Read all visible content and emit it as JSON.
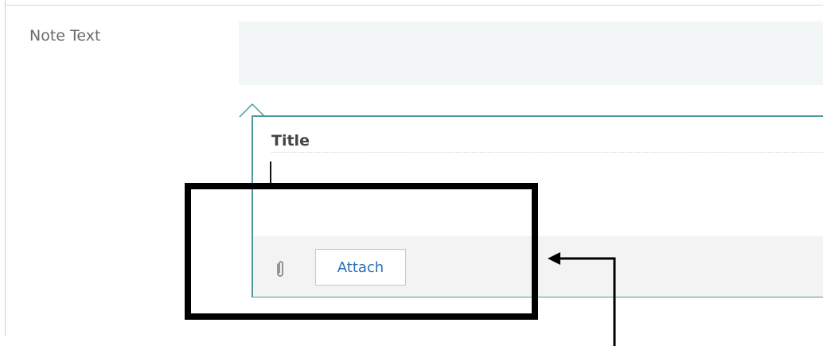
{
  "form": {
    "note_text_label": "Note Text"
  },
  "composer": {
    "title_placeholder": "Title",
    "body_value": ""
  },
  "attachments": {
    "attach_label": "Attach"
  },
  "icons": {
    "attachment": "paperclip-icon",
    "pointer": "caret-up-icon",
    "annotation": "arrow-left-icon"
  },
  "colors": {
    "accent_border": "#4d9999",
    "link_blue": "#2b6fb6",
    "highlight": "#000000"
  }
}
